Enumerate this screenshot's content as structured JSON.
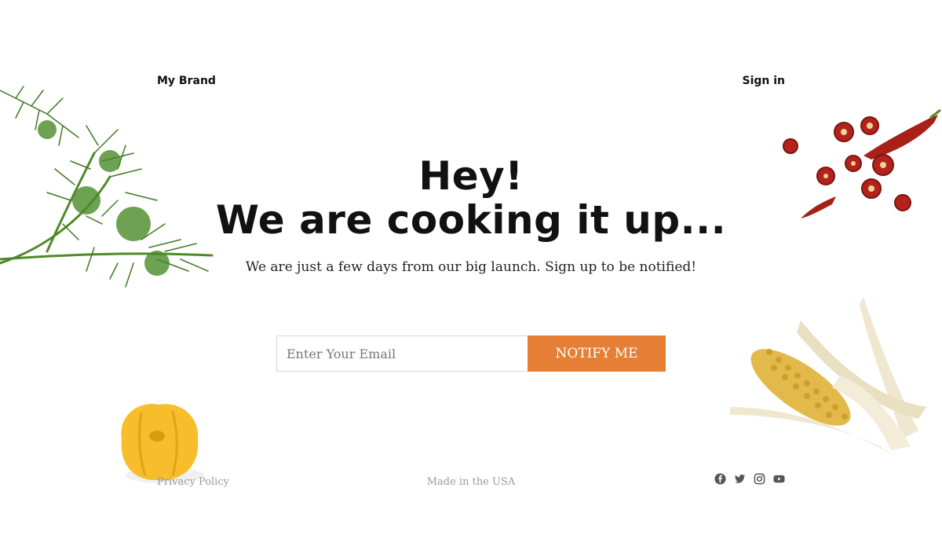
{
  "header": {
    "brand": "My Brand",
    "signin_label": "Sign in"
  },
  "hero": {
    "title_line1": "Hey!",
    "title_line2": "We are cooking it up...",
    "subtitle": "We are just a few days from our big launch. Sign up to be notified!"
  },
  "form": {
    "email_placeholder": "Enter Your Email",
    "email_value": "",
    "notify_label": "NOTIFY ME"
  },
  "footer": {
    "privacy_label": "Privacy Policy",
    "made_in": "Made in the USA",
    "social_icons": [
      "facebook-icon",
      "twitter-icon",
      "instagram-icon",
      "youtube-icon"
    ]
  },
  "colors": {
    "accent": "#e67e35",
    "text": "#111111",
    "muted": "#999999"
  }
}
